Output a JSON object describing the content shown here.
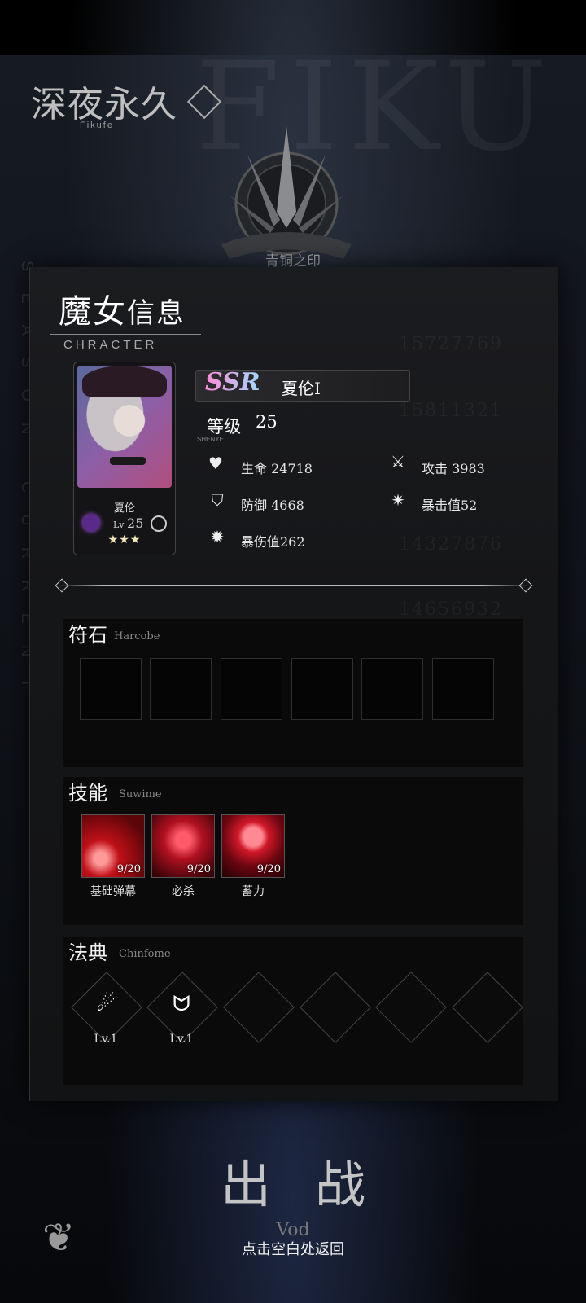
{
  "header": {
    "logo_cn": "深夜永久",
    "logo_en": "Fikufe",
    "rank": "青铜之印"
  },
  "panel": {
    "title_cn_a": "魔女",
    "title_cn_b": "信息",
    "title_en": "CHRACTER"
  },
  "character": {
    "rarity": "SSR",
    "name": "夏伦I",
    "card_name": "夏伦",
    "level_label": "等级",
    "level": "25",
    "level_sub": "SHENYE",
    "card_lv_prefix": "Lv",
    "card_lv": "25",
    "stars": "★★★",
    "element_color": "#9a4ad0"
  },
  "stats": {
    "hp": "生命 24718",
    "atk": "攻击 3983",
    "def": "防御 4668",
    "crit": "暴击值52",
    "crit_dmg": "暴伤值262"
  },
  "runes": {
    "title": "符石",
    "subtitle": "Harcobe"
  },
  "skills": {
    "title": "技能",
    "subtitle": "Suwime",
    "items": [
      {
        "name": "基础弹幕",
        "progress": "9/20"
      },
      {
        "name": "必杀",
        "progress": "9/20"
      },
      {
        "name": "蓄力",
        "progress": "9/20"
      }
    ]
  },
  "tomes": {
    "title": "法典",
    "subtitle": "Chinfome",
    "items": [
      {
        "level": "Lv.1",
        "icon": "comet-icon"
      },
      {
        "level": "Lv.1",
        "icon": "ghost-flame-icon"
      }
    ]
  },
  "footer": {
    "battle": "出战",
    "vod": "Vod",
    "back_hint": "点击空白处返回"
  }
}
